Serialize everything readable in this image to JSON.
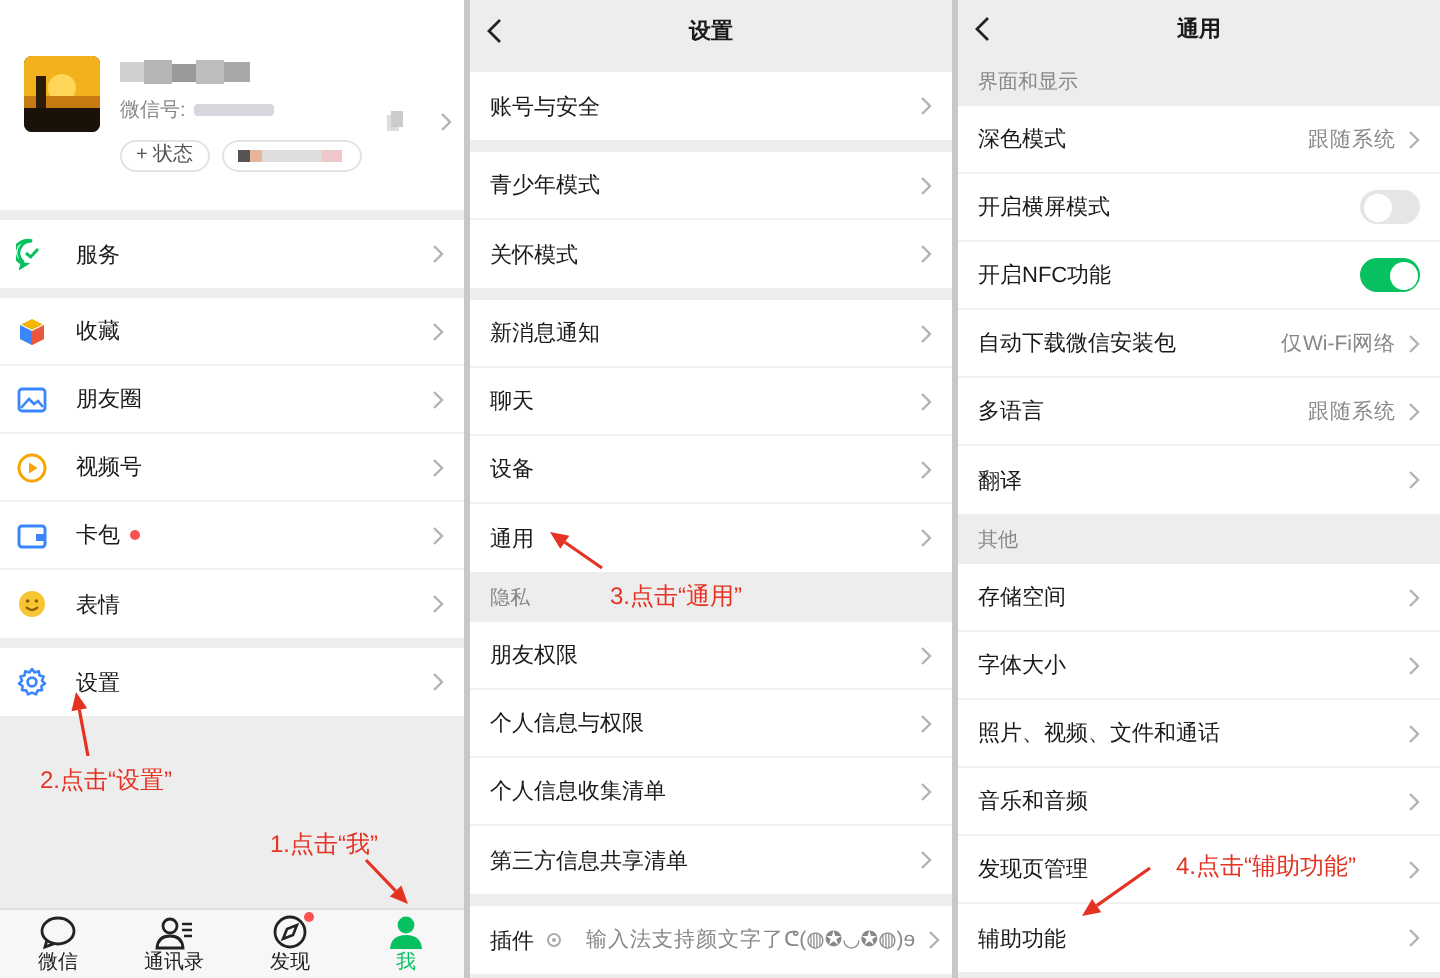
{
  "me": {
    "profile": {
      "id_label": "微信号:",
      "status_button": "+ 状态"
    },
    "groups": [
      [
        {
          "label": "服务",
          "dot": false
        }
      ],
      [
        {
          "label": "收藏",
          "dot": false
        },
        {
          "label": "朋友圈",
          "dot": false
        },
        {
          "label": "视频号",
          "dot": false
        },
        {
          "label": "卡包",
          "dot": true
        },
        {
          "label": "表情",
          "dot": false
        }
      ],
      [
        {
          "label": "设置",
          "dot": false
        }
      ]
    ],
    "annotations": [
      {
        "text": "2.点击“设置”"
      },
      {
        "text": "1.点击“我”"
      }
    ],
    "tabs": [
      {
        "label": "微信",
        "selected": false,
        "dot": false
      },
      {
        "label": "通讯录",
        "selected": false,
        "dot": false
      },
      {
        "label": "发现",
        "selected": false,
        "dot": true
      },
      {
        "label": "我",
        "selected": true,
        "dot": false
      }
    ]
  },
  "settings": {
    "title": "设置",
    "groups": [
      {
        "items": [
          {
            "kind": "link",
            "label": "账号与安全"
          }
        ]
      },
      {
        "items": [
          {
            "kind": "link",
            "label": "青少年模式"
          },
          {
            "kind": "link",
            "label": "关怀模式"
          }
        ]
      },
      {
        "items": [
          {
            "kind": "link",
            "label": "新消息通知"
          },
          {
            "kind": "link",
            "label": "聊天"
          },
          {
            "kind": "link",
            "label": "设备"
          },
          {
            "kind": "link",
            "label": "通用"
          }
        ]
      },
      {
        "header": "隐私",
        "items": [
          {
            "kind": "link",
            "label": "朋友权限"
          },
          {
            "kind": "link",
            "label": "个人信息与权限"
          },
          {
            "kind": "link",
            "label": "个人信息收集清单"
          },
          {
            "kind": "link",
            "label": "第三方信息共享清单"
          }
        ]
      },
      {
        "items": [
          {
            "kind": "plugin",
            "label": "插件",
            "value": "输入法支持颜文字了ᕦ(◍✪◡✪◍)ɘ"
          }
        ]
      }
    ],
    "annotations": [
      {
        "text": "3.点击“通用”"
      }
    ]
  },
  "general": {
    "title": "通用",
    "groups": [
      {
        "header": "界面和显示",
        "items": [
          {
            "kind": "link",
            "label": "深色模式",
            "value": "跟随系统"
          },
          {
            "kind": "toggle",
            "label": "开启横屏模式",
            "on": false
          },
          {
            "kind": "toggle",
            "label": "开启NFC功能",
            "on": true
          },
          {
            "kind": "link",
            "label": "自动下载微信安装包",
            "value": "仅Wi-Fi网络"
          },
          {
            "kind": "link",
            "label": "多语言",
            "value": "跟随系统"
          },
          {
            "kind": "link",
            "label": "翻译"
          }
        ]
      },
      {
        "header": "其他",
        "items": [
          {
            "kind": "link",
            "label": "存储空间"
          },
          {
            "kind": "link",
            "label": "字体大小"
          },
          {
            "kind": "link",
            "label": "照片、视频、文件和通话"
          },
          {
            "kind": "link",
            "label": "音乐和音频"
          },
          {
            "kind": "link",
            "label": "发现页管理"
          },
          {
            "kind": "link",
            "label": "辅助功能"
          }
        ]
      }
    ],
    "annotations": [
      {
        "text": "4.点击“辅助功能”"
      }
    ]
  }
}
